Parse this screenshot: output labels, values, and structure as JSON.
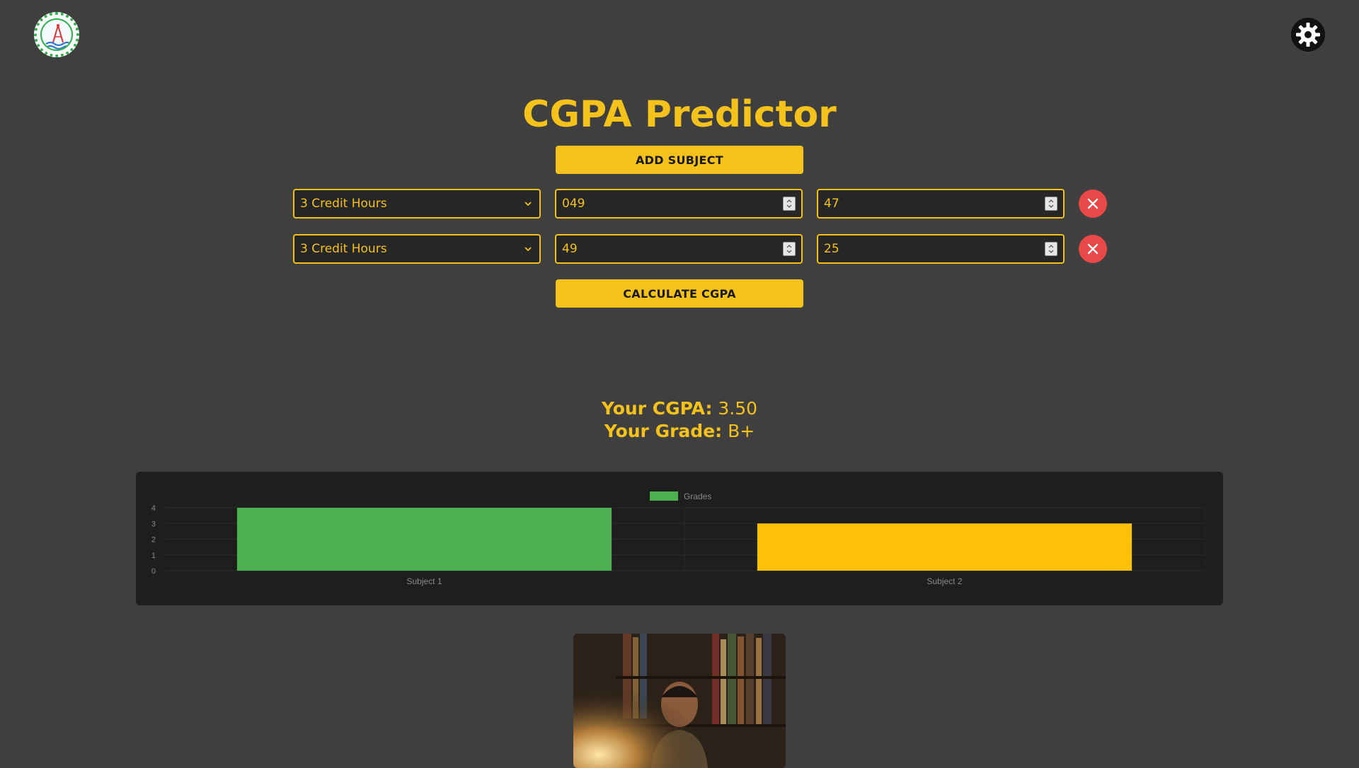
{
  "header": {
    "logo_icon": "university-logo-icon",
    "theme_toggle_icon": "gear-icon"
  },
  "page": {
    "title": "CGPA Predictor"
  },
  "actions": {
    "add_subject_label": "ADD SUBJECT",
    "calculate_label": "CALCULATE CGPA"
  },
  "subjects": [
    {
      "credit_hours": "3 Credit Hours",
      "marks_1": "049",
      "marks_2": "47"
    },
    {
      "credit_hours": "3 Credit Hours",
      "marks_1": "49",
      "marks_2": "25"
    }
  ],
  "results": {
    "cgpa_label": "Your CGPA:",
    "cgpa_value": "3.50",
    "grade_label": "Your Grade:",
    "grade_value": "B+"
  },
  "colors": {
    "accent": "#f5c21b",
    "danger": "#ea4949",
    "background": "#3f3f3f",
    "card": "#1e1e1e",
    "bar_green": "#4caf50",
    "bar_yellow": "#ffc107"
  },
  "chart_data": {
    "type": "bar",
    "categories": [
      "Subject 1",
      "Subject 2"
    ],
    "series": [
      {
        "name": "Grades",
        "values": [
          4,
          3
        ]
      }
    ],
    "bar_colors": [
      "#4caf50",
      "#ffc107"
    ],
    "y_ticks": [
      "0",
      "1",
      "2",
      "3",
      "4"
    ],
    "ylim": [
      0,
      4
    ],
    "legend": "top-center",
    "grid": true
  },
  "media": {
    "photo_alt": "animated-reaction-gif"
  }
}
